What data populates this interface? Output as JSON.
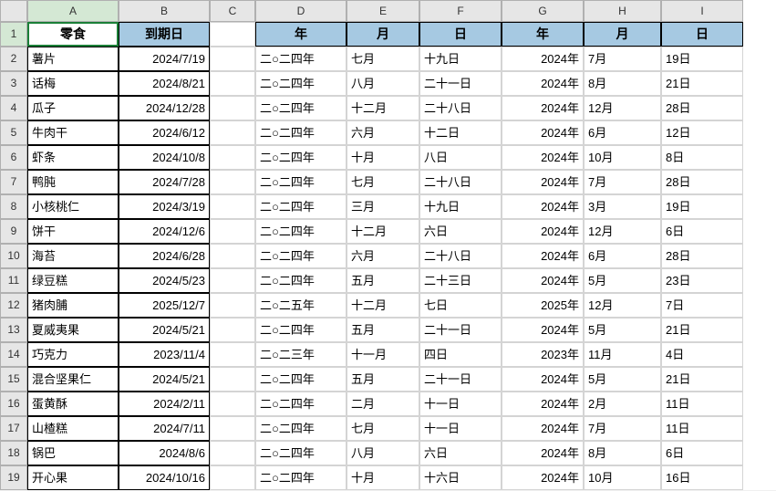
{
  "columns": [
    "A",
    "B",
    "C",
    "D",
    "E",
    "F",
    "G",
    "H",
    "I"
  ],
  "selectedCell": "A1",
  "headers": {
    "A": "零食",
    "B": "到期日",
    "D": "年",
    "E": "月",
    "F": "日",
    "G": "年",
    "H": "月",
    "I": "日"
  },
  "rows": [
    {
      "A": "薯片",
      "B": "2024/7/19",
      "D": "二○二四年",
      "E": "七月",
      "F": "十九日",
      "G": "2024年",
      "H": "7月",
      "I": "19日"
    },
    {
      "A": "话梅",
      "B": "2024/8/21",
      "D": "二○二四年",
      "E": "八月",
      "F": "二十一日",
      "G": "2024年",
      "H": "8月",
      "I": "21日"
    },
    {
      "A": "瓜子",
      "B": "2024/12/28",
      "D": "二○二四年",
      "E": "十二月",
      "F": "二十八日",
      "G": "2024年",
      "H": "12月",
      "I": "28日"
    },
    {
      "A": "牛肉干",
      "B": "2024/6/12",
      "D": "二○二四年",
      "E": "六月",
      "F": "十二日",
      "G": "2024年",
      "H": "6月",
      "I": "12日"
    },
    {
      "A": "虾条",
      "B": "2024/10/8",
      "D": "二○二四年",
      "E": "十月",
      "F": "八日",
      "G": "2024年",
      "H": "10月",
      "I": "8日"
    },
    {
      "A": "鸭肫",
      "B": "2024/7/28",
      "D": "二○二四年",
      "E": "七月",
      "F": "二十八日",
      "G": "2024年",
      "H": "7月",
      "I": "28日"
    },
    {
      "A": "小核桃仁",
      "B": "2024/3/19",
      "D": "二○二四年",
      "E": "三月",
      "F": "十九日",
      "G": "2024年",
      "H": "3月",
      "I": "19日"
    },
    {
      "A": "饼干",
      "B": "2024/12/6",
      "D": "二○二四年",
      "E": "十二月",
      "F": "六日",
      "G": "2024年",
      "H": "12月",
      "I": "6日"
    },
    {
      "A": "海苔",
      "B": "2024/6/28",
      "D": "二○二四年",
      "E": "六月",
      "F": "二十八日",
      "G": "2024年",
      "H": "6月",
      "I": "28日"
    },
    {
      "A": "绿豆糕",
      "B": "2024/5/23",
      "D": "二○二四年",
      "E": "五月",
      "F": "二十三日",
      "G": "2024年",
      "H": "5月",
      "I": "23日"
    },
    {
      "A": "猪肉脯",
      "B": "2025/12/7",
      "D": "二○二五年",
      "E": "十二月",
      "F": "七日",
      "G": "2025年",
      "H": "12月",
      "I": "7日"
    },
    {
      "A": "夏威夷果",
      "B": "2024/5/21",
      "D": "二○二四年",
      "E": "五月",
      "F": "二十一日",
      "G": "2024年",
      "H": "5月",
      "I": "21日"
    },
    {
      "A": "巧克力",
      "B": "2023/11/4",
      "D": "二○二三年",
      "E": "十一月",
      "F": "四日",
      "G": "2023年",
      "H": "11月",
      "I": "4日"
    },
    {
      "A": "混合坚果仁",
      "B": "2024/5/21",
      "D": "二○二四年",
      "E": "五月",
      "F": "二十一日",
      "G": "2024年",
      "H": "5月",
      "I": "21日"
    },
    {
      "A": "蛋黄酥",
      "B": "2024/2/11",
      "D": "二○二四年",
      "E": "二月",
      "F": "十一日",
      "G": "2024年",
      "H": "2月",
      "I": "11日"
    },
    {
      "A": "山楂糕",
      "B": "2024/7/11",
      "D": "二○二四年",
      "E": "七月",
      "F": "十一日",
      "G": "2024年",
      "H": "7月",
      "I": "11日"
    },
    {
      "A": "锅巴",
      "B": "2024/8/6",
      "D": "二○二四年",
      "E": "八月",
      "F": "六日",
      "G": "2024年",
      "H": "8月",
      "I": "6日"
    },
    {
      "A": "开心果",
      "B": "2024/10/16",
      "D": "二○二四年",
      "E": "十月",
      "F": "十六日",
      "G": "2024年",
      "H": "10月",
      "I": "16日"
    }
  ]
}
